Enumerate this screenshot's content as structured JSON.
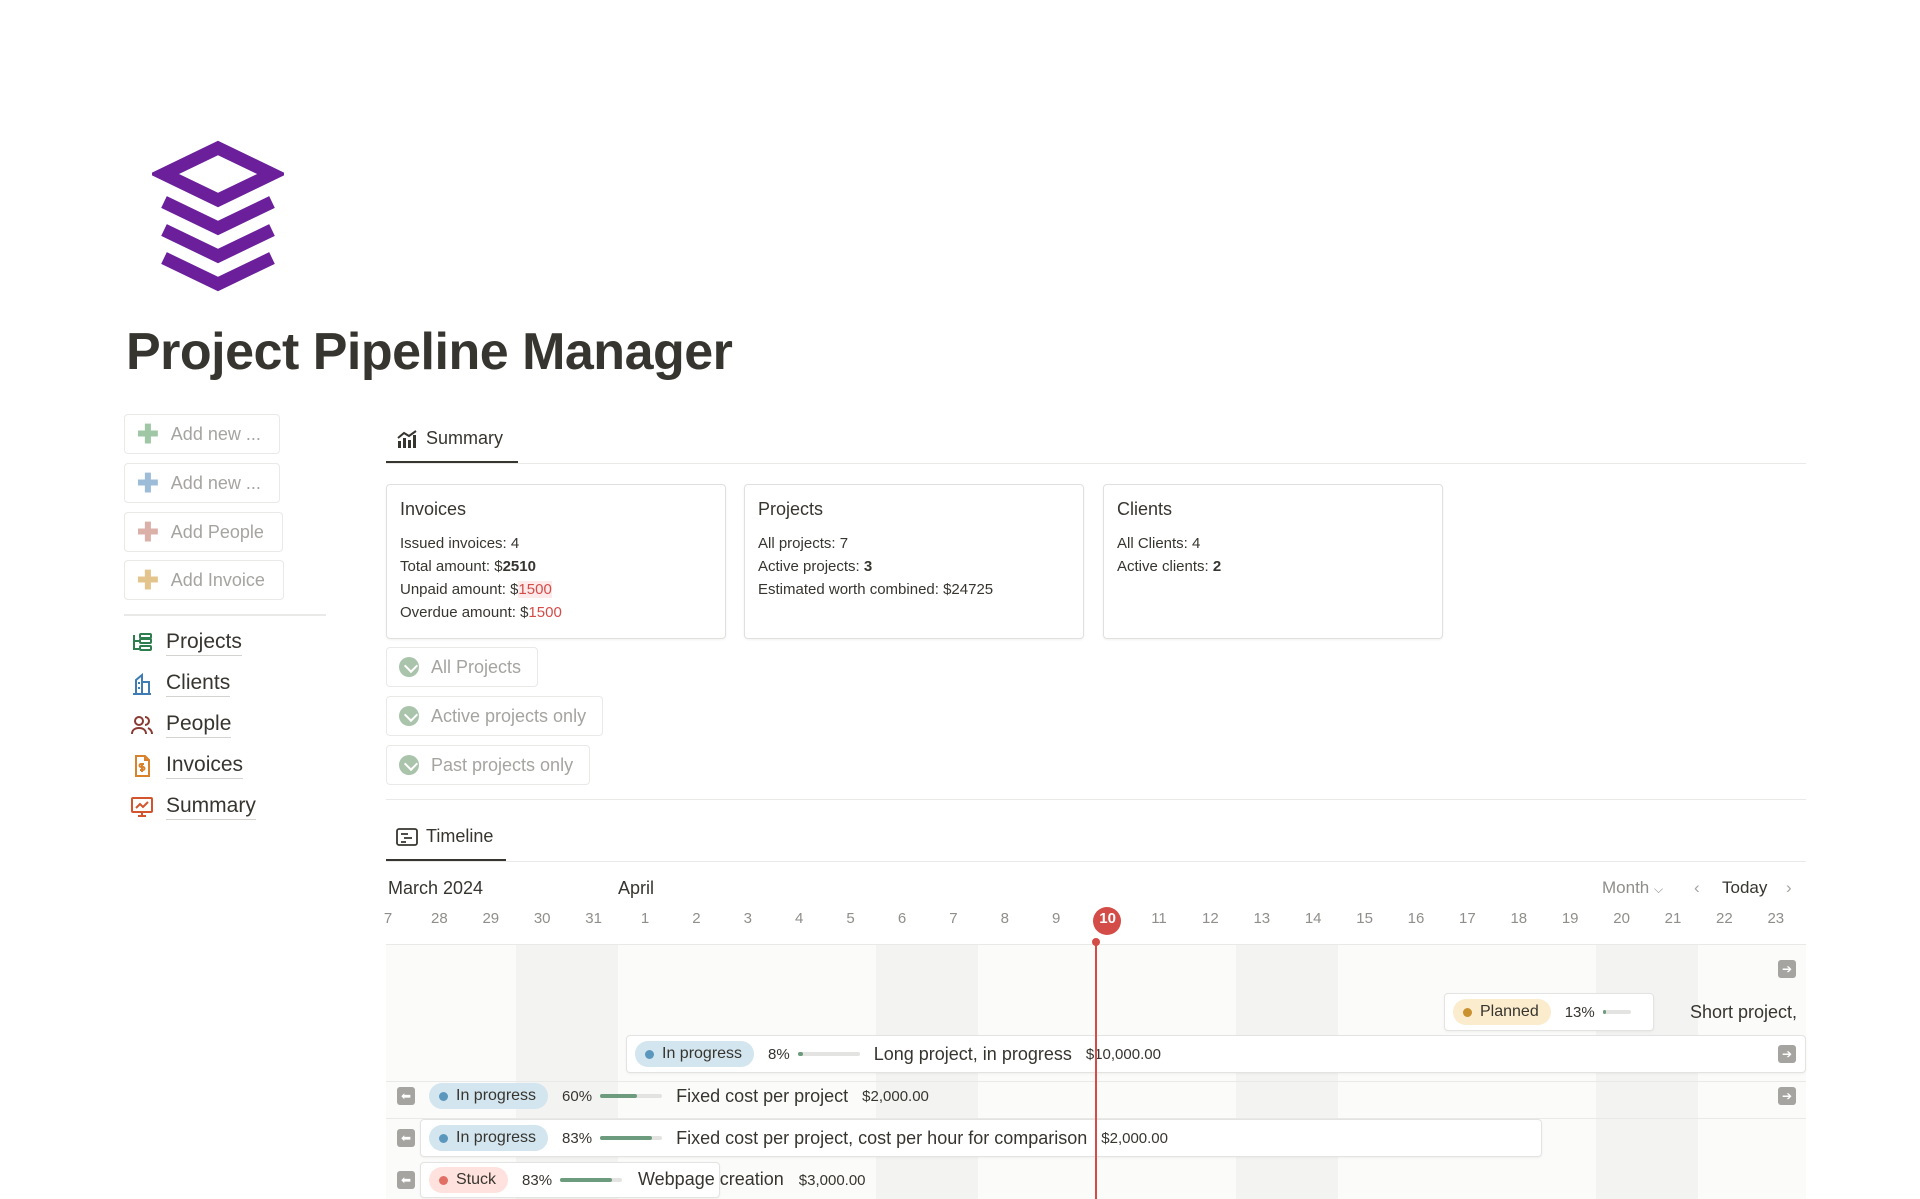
{
  "page": {
    "title": "Project Pipeline Manager",
    "logo": "stacked-layers-logo",
    "accent": "#6b1f9b"
  },
  "left": {
    "buttons": [
      {
        "label": "Add new ...",
        "color": "#9fc7a6"
      },
      {
        "label": "Add new ...",
        "color": "#9dbcd8"
      },
      {
        "label": "Add People",
        "color": "#dab0a8"
      },
      {
        "label": "Add Invoice",
        "color": "#e4c48d"
      }
    ],
    "nav": [
      {
        "label": "Projects",
        "icon": "projects-icon",
        "color": "#2e7d4f"
      },
      {
        "label": "Clients",
        "icon": "building-icon",
        "color": "#3f7bb5"
      },
      {
        "label": "People",
        "icon": "people-icon",
        "color": "#8a3a33"
      },
      {
        "label": "Invoices",
        "icon": "invoice-icon",
        "color": "#d9822b"
      },
      {
        "label": "Summary",
        "icon": "presentation-chart-icon",
        "color": "#d4542e"
      }
    ]
  },
  "summary_tab": {
    "label": "Summary"
  },
  "cards": {
    "invoices": {
      "title": "Invoices",
      "issued_label": "Issued invoices: ",
      "issued": "4",
      "total_label": "Total amount: ",
      "total_prefix": "$",
      "total": "2510",
      "unpaid_label": "Unpaid amount: ",
      "unpaid_prefix": "$",
      "unpaid": "1500",
      "overdue_label": "Overdue amount: ",
      "overdue_prefix": "$",
      "overdue": "1500"
    },
    "projects": {
      "title": "Projects",
      "all_label": "All projects: ",
      "all": "7",
      "active_label": "Active projects: ",
      "active": "3",
      "worth_label": "Estimated worth combined: ",
      "worth": "$24725"
    },
    "clients": {
      "title": "Clients",
      "all_label": "All Clients: ",
      "all": "4",
      "active_label": "Active clients: ",
      "active": "2"
    }
  },
  "filters": [
    "All Projects",
    "Active projects only",
    "Past projects only"
  ],
  "timeline_tab": {
    "label": "Timeline"
  },
  "timeline": {
    "month_left": "March 2024",
    "month_right": "April",
    "view": "Month",
    "today_button": "Today",
    "days": [
      "7",
      "28",
      "29",
      "30",
      "31",
      "1",
      "2",
      "3",
      "4",
      "5",
      "6",
      "7",
      "8",
      "9",
      "10",
      "11",
      "12",
      "13",
      "14",
      "15",
      "16",
      "17",
      "18",
      "19",
      "20",
      "21",
      "22",
      "23"
    ],
    "today": "10",
    "rows": [
      {
        "status": "Planned",
        "status_color": "yellow",
        "percent": "13%",
        "progress": 0.13,
        "name": "Short project,",
        "amount": ""
      },
      {
        "status": "In progress",
        "status_color": "blue",
        "percent": "8%",
        "progress": 0.08,
        "name": "Long project, in progress",
        "amount": "$10,000.00"
      },
      {
        "status": "In progress",
        "status_color": "blue",
        "percent": "60%",
        "progress": 0.6,
        "name": "Fixed cost per project",
        "amount": "$2,000.00"
      },
      {
        "status": "In progress",
        "status_color": "blue",
        "percent": "83%",
        "progress": 0.83,
        "name": "Fixed cost per project, cost per hour for comparison",
        "amount": "$2,000.00"
      },
      {
        "status": "Stuck",
        "status_color": "red",
        "percent": "83%",
        "progress": 0.83,
        "name": "Webpage creation",
        "amount": "$3,000.00"
      }
    ]
  }
}
